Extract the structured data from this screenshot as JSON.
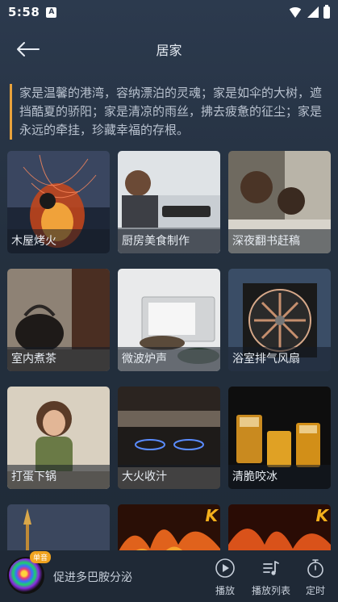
{
  "status": {
    "time": "5:58",
    "badge": "A"
  },
  "header": {
    "title": "居家"
  },
  "intro": "家是温馨的港湾，容纳漂泊的灵魂；家是如伞的大树，遮挡酷夏的骄阳；家是清凉的雨丝，拂去疲惫的征尘；家是永远的牵挂，珍藏幸福的存根。",
  "tiles": [
    {
      "label": "木屋烤火",
      "icon": "bonfire"
    },
    {
      "label": "厨房美食制作",
      "icon": "kitchen-cooking"
    },
    {
      "label": "深夜翻书赶稿",
      "icon": "reading-night"
    },
    {
      "label": "室内煮茶",
      "icon": "teapot"
    },
    {
      "label": "微波炉声",
      "icon": "microwave"
    },
    {
      "label": "浴室排气风扇",
      "icon": "exhaust-fan"
    },
    {
      "label": "打蛋下锅",
      "icon": "woman-cooking"
    },
    {
      "label": "大火收汁",
      "icon": "gas-stove"
    },
    {
      "label": "清脆咬冰",
      "icon": "ice-drinks"
    },
    {
      "label": "",
      "icon": "lamp"
    },
    {
      "label": "",
      "icon": "fire",
      "vip": "K"
    },
    {
      "label": "",
      "icon": "fire",
      "vip": "K"
    }
  ],
  "player": {
    "badge": "单音",
    "track": "促进多巴胺分泌",
    "play_label": "播放",
    "playlist_label": "播放列表",
    "timer_label": "定时"
  }
}
